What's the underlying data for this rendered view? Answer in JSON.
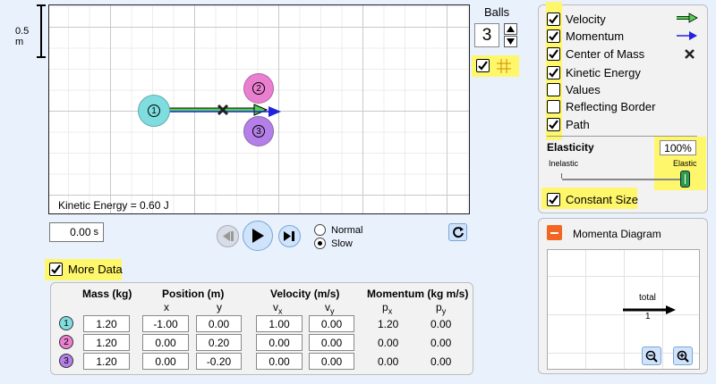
{
  "ruler": {
    "label": "0.5 m"
  },
  "play_area": {
    "kinetic_energy_label": "Kinetic Energy = 0.60 J",
    "balls": [
      {
        "number": "1",
        "color": "#7fdde0"
      },
      {
        "number": "2",
        "color": "#ea7fd0"
      },
      {
        "number": "3",
        "color": "#b47fe8"
      }
    ]
  },
  "balls_control": {
    "title": "Balls",
    "count": "3"
  },
  "time": {
    "value": "0.00",
    "unit": "s"
  },
  "speed": {
    "normal_label": "Normal",
    "slow_label": "Slow",
    "selected": "Slow"
  },
  "options": {
    "velocity": "Velocity",
    "momentum": "Momentum",
    "center_of_mass": "Center of Mass",
    "kinetic_energy": "Kinetic Energy",
    "values": "Values",
    "reflecting_border": "Reflecting Border",
    "path": "Path"
  },
  "elasticity": {
    "title": "Elasticity",
    "value": "100%",
    "inelastic_label": "Inelastic",
    "elastic_label": "Elastic",
    "level_percent": 100
  },
  "constant_size": {
    "label": "Constant Size"
  },
  "momenta_diagram": {
    "title": "Momenta Diagram",
    "total_label": "total",
    "total_value": "1"
  },
  "more_data": {
    "label": "More Data"
  },
  "table": {
    "headers": {
      "mass": "Mass (kg)",
      "position": "Position (m)",
      "velocity": "Velocity (m/s)",
      "momentum": "Momentum (kg m/s)"
    },
    "subheaders": {
      "x": "x",
      "y": "y",
      "vx": "v",
      "vx_sub": "x",
      "vy": "v",
      "vy_sub": "y",
      "px": "p",
      "px_sub": "x",
      "py": "p",
      "py_sub": "y"
    },
    "rows": [
      {
        "num": "1",
        "mass": "1.20",
        "x": "-1.00",
        "y": "0.00",
        "vx": "1.00",
        "vy": "0.00",
        "px": "1.20",
        "py": "0.00"
      },
      {
        "num": "2",
        "mass": "1.20",
        "x": "0.00",
        "y": "0.20",
        "vx": "0.00",
        "vy": "0.00",
        "px": "0.00",
        "py": "0.00"
      },
      {
        "num": "3",
        "mass": "1.20",
        "x": "0.00",
        "y": "-0.20",
        "vx": "0.00",
        "vy": "0.00",
        "px": "0.00",
        "py": "0.00"
      }
    ]
  },
  "colors": {
    "velocity_arrow": "#4fd14f",
    "momentum_arrow": "#2222dd",
    "highlight": "#fff76b",
    "background": "#e8f1fc"
  }
}
